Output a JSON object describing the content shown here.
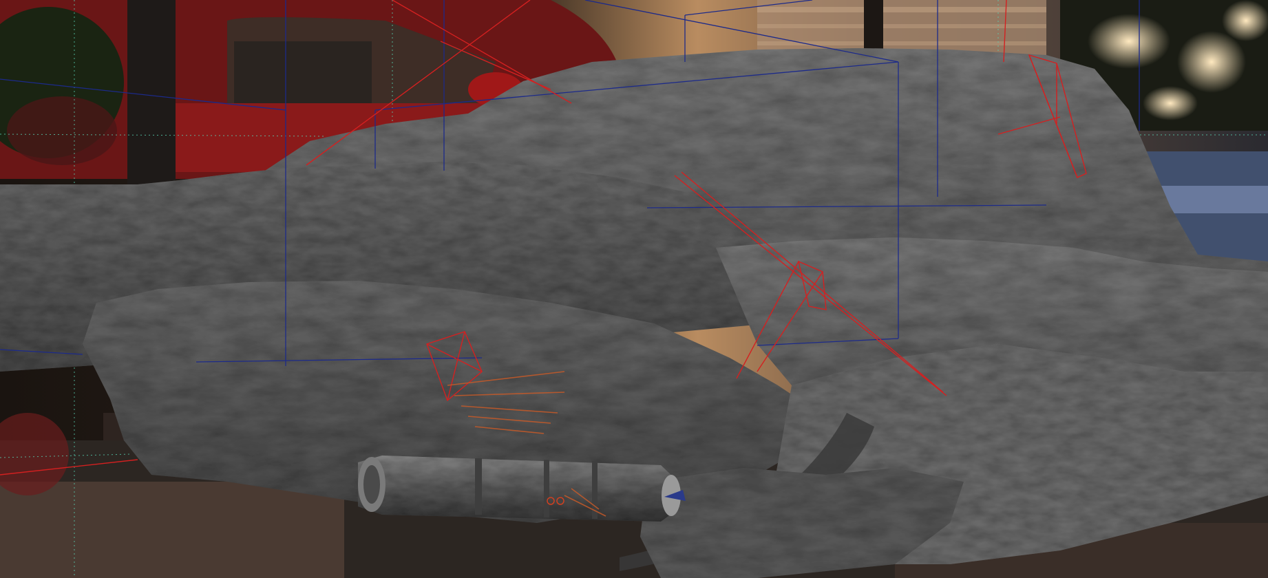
{
  "viewport": {
    "kind": "3d-viewport",
    "background": "camera-plate-photo",
    "mesh_color": "#5a5a5a",
    "camera_frustum_color": "#d42020",
    "bounding_box_color": "#1c2a8a",
    "grid_color": "#57d3b4",
    "objects": [
      "terrain-mesh",
      "cylindrical-machine-model",
      "camera-frustums",
      "bounding-box-wireframe",
      "guide-grid"
    ]
  }
}
